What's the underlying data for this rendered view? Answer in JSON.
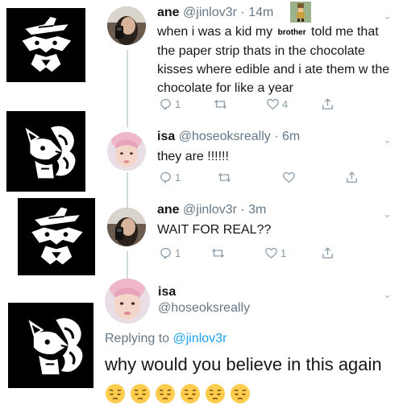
{
  "tweets": [
    {
      "name": "ane",
      "handle": "@jinlov3r",
      "time": "· 14m",
      "text_before": "when i was a kid my ",
      "badge": "brother",
      "text_after": " told me that the paper strip thats in the chocolate kisses where edible and i ate them w the chocolate for like a year",
      "replies": "1",
      "retweets": "",
      "likes": "4"
    },
    {
      "name": "isa",
      "handle": "@hoseoksreally",
      "time": "· 6m",
      "text": "they are !!!!!!",
      "replies": "1",
      "retweets": "",
      "likes": ""
    },
    {
      "name": "ane",
      "handle": "@jinlov3r",
      "time": "· 3m",
      "text": "WAIT FOR REAL??",
      "replies": "1",
      "retweets": "",
      "likes": "1"
    }
  ],
  "final": {
    "name": "isa",
    "handle": "@hoseoksreally",
    "replying_prefix": "Replying to ",
    "replying_handle": "@jinlov3r",
    "text": "why would you believe in this again",
    "emoji": [
      "pensive-face",
      "pensive-face",
      "pensive-face",
      "pensive-face",
      "pensive-face",
      "pensive-face"
    ]
  },
  "icons": {
    "reply": "reply-icon",
    "retweet": "retweet-icon",
    "like": "heart-icon",
    "share": "share-icon"
  },
  "colors": {
    "link": "#1da1f2",
    "secondary": "#657786",
    "icon": "#8899a6"
  }
}
